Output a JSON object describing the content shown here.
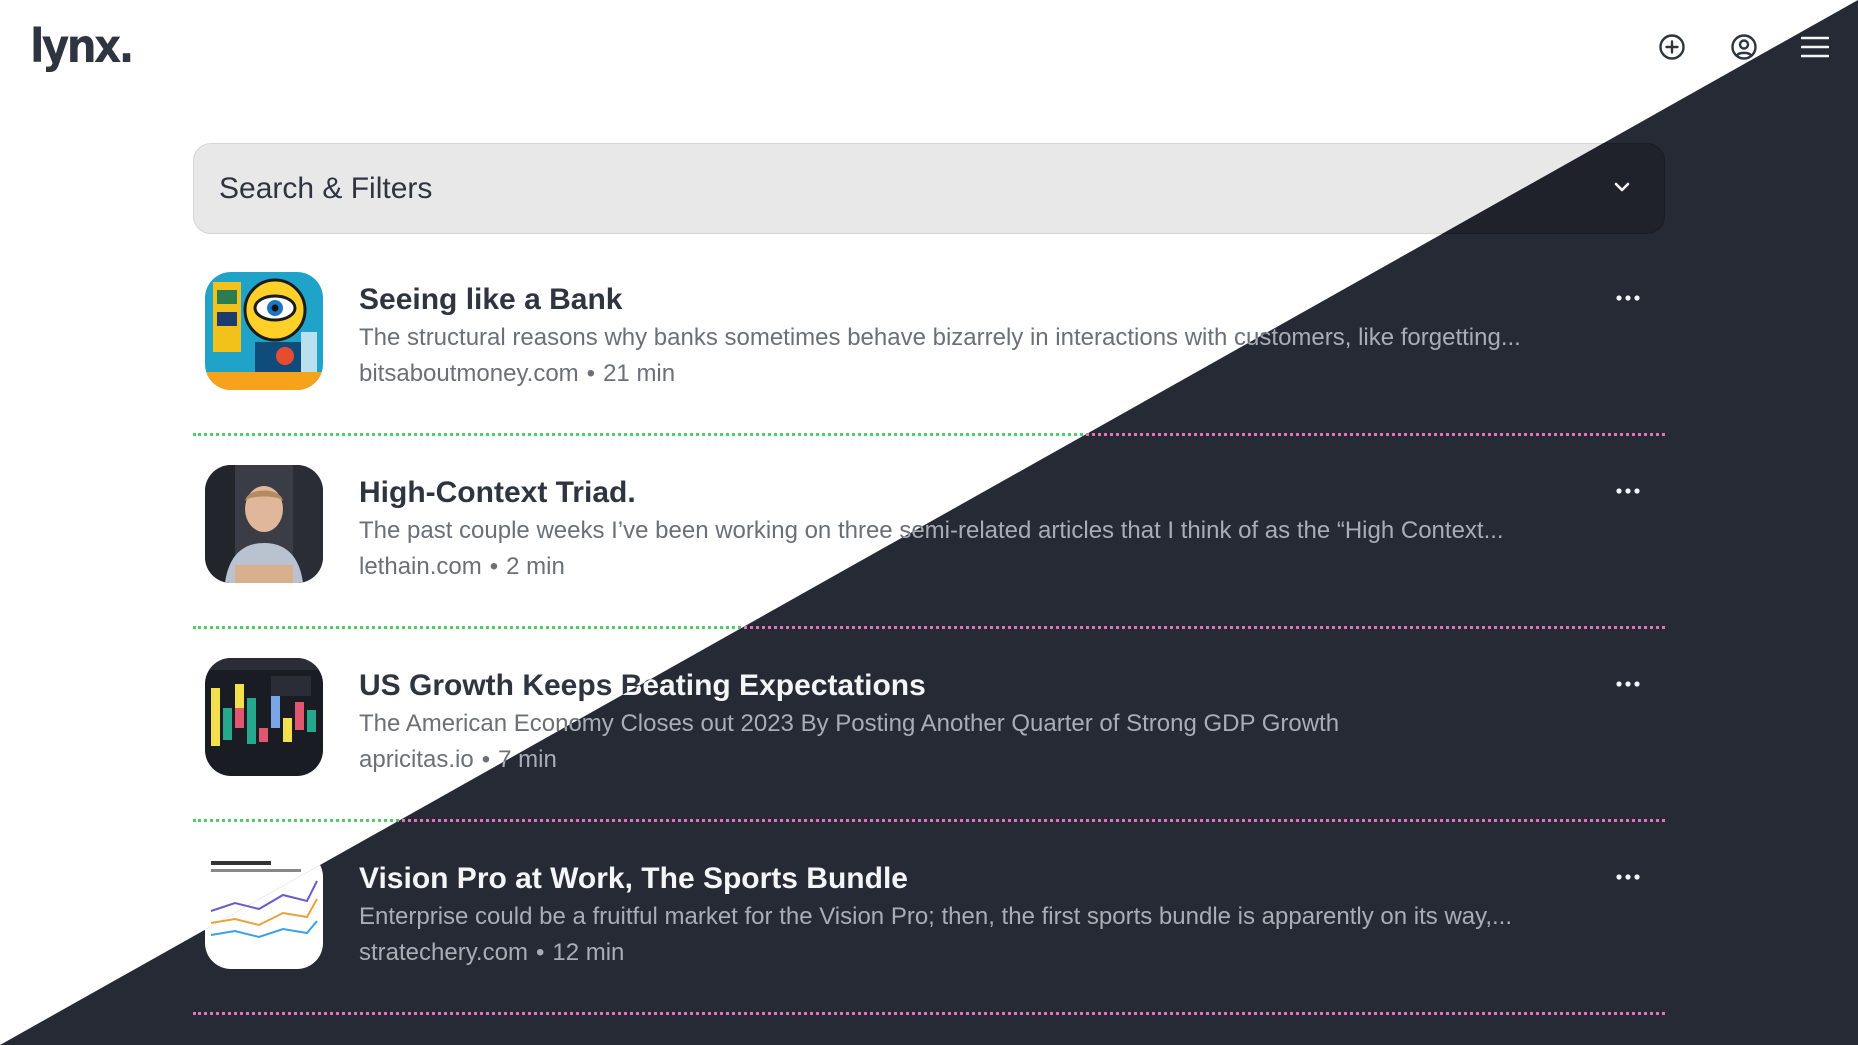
{
  "app": {
    "logo": "lynx."
  },
  "header": {
    "icons": [
      "add-circle-icon",
      "user-circle-icon",
      "hamburger-menu-icon"
    ]
  },
  "search": {
    "label": "Search & Filters"
  },
  "articles": [
    {
      "title": "Seeing like a Bank",
      "description": "The structural reasons why banks sometimes behave bizarrely in interactions with customers, like forgetting...",
      "source": "bitsaboutmoney.com",
      "separator": "•",
      "read_time": "21 min"
    },
    {
      "title": "High-Context Triad.",
      "description": "The past couple weeks I’ve been working on three semi-related articles that I think of as the “High Context...",
      "source": "lethain.com",
      "separator": "•",
      "read_time": "2 min"
    },
    {
      "title": "US Growth Keeps Beating Expectations",
      "description": "The American Economy Closes out 2023 By Posting Another Quarter of Strong GDP Growth",
      "source": "apricitas.io",
      "separator": "•",
      "read_time": "7 min"
    },
    {
      "title": "Vision Pro at Work, The Sports Bundle",
      "description": "Enterprise could be a fruitful market for the Vision Pro; then, the first sports bundle is apparently on its way,...",
      "source": "stratechery.com",
      "separator": "•",
      "read_time": "12 min"
    }
  ],
  "colors": {
    "light_bg": "#ffffff",
    "dark_bg": "#262a35",
    "light_separator": "#55c96b",
    "dark_separator": "#e373b8"
  }
}
